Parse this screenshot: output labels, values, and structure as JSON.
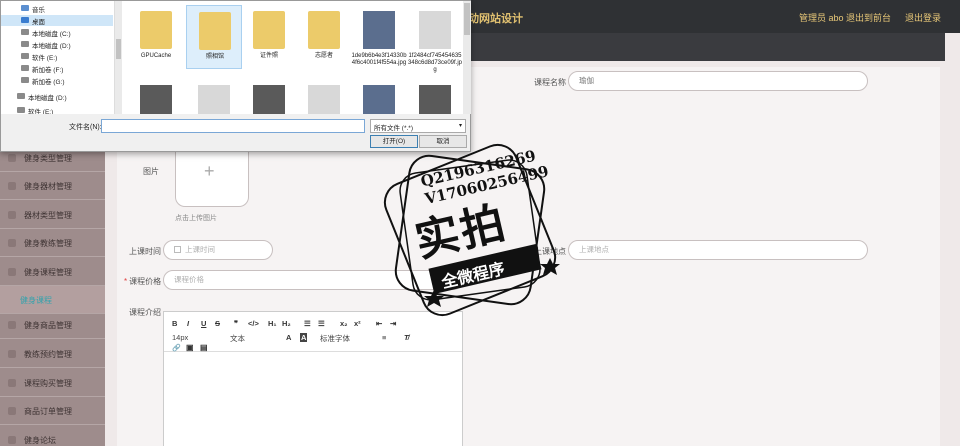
{
  "header": {
    "title_visible": "动网站设计",
    "admin_label": "管理员 abo",
    "goto_front": "退出到前台",
    "logout": "退出登录"
  },
  "sidebar": {
    "items": [
      {
        "label": "健身类型管理"
      },
      {
        "label": "健身器材管理"
      },
      {
        "label": "器材类型管理"
      },
      {
        "label": "健身教练管理"
      },
      {
        "label": "健身课程管理"
      },
      {
        "label": "健身课程",
        "active": true
      },
      {
        "label": "健身商品管理"
      },
      {
        "label": "教练预约管理"
      },
      {
        "label": "课程购买管理"
      },
      {
        "label": "商品订单管理"
      },
      {
        "label": "健身论坛"
      }
    ]
  },
  "form": {
    "course_name_label": "课程名称",
    "course_name_value": "瑜伽",
    "image_label": "图片",
    "upload_hint": "点击上传图片",
    "start_time_label": "上课时间",
    "start_time_placeholder": "上课时间",
    "location_label": "上课地点",
    "location_placeholder": "上课地点",
    "price_label": "课程价格",
    "price_placeholder": "课程价格",
    "intro_label": "课程介绍"
  },
  "editor": {
    "font_size": "14px",
    "block_type": "文本",
    "font_family": "标准字体"
  },
  "dialog": {
    "tree": [
      {
        "label": "音乐"
      },
      {
        "label": "桌面",
        "selected": true
      },
      {
        "label": "本地磁盘 (C:)"
      },
      {
        "label": "本地磁盘 (D:)"
      },
      {
        "label": "软件 (E:)"
      },
      {
        "label": "新加卷 (F:)"
      },
      {
        "label": "新加卷 (G:)"
      },
      {
        "label": "本地磁盘 (D:)"
      },
      {
        "label": "软件 (E:)"
      }
    ],
    "files": [
      {
        "name": "GPUCache",
        "kind": "folder"
      },
      {
        "name": "照相馆",
        "kind": "folder",
        "selected": true
      },
      {
        "name": "证件照",
        "kind": "folder"
      },
      {
        "name": "志愿者",
        "kind": "folder"
      },
      {
        "name": "1de9b6b4e3f14330b4f6c4001f4f554a.jpg",
        "kind": "photo"
      },
      {
        "name": "1f2484cf745454635348c6d8d73ce09f.jpg",
        "kind": "photo"
      },
      {
        "name": "",
        "kind": "photo"
      },
      {
        "name": "",
        "kind": "photo"
      },
      {
        "name": "",
        "kind": "photo"
      },
      {
        "name": "",
        "kind": "photo"
      },
      {
        "name": "",
        "kind": "photo"
      },
      {
        "name": "",
        "kind": "photo"
      }
    ],
    "filename_label": "文件名(N):",
    "filename_value": "",
    "filter": "所有文件 (*.*)",
    "open_button": "打开(O)",
    "cancel_button": "取消"
  },
  "watermark": {
    "line1": "Q2196316269",
    "line2": "V17060256499",
    "big": "实拍",
    "ribbon": "全微程序"
  }
}
